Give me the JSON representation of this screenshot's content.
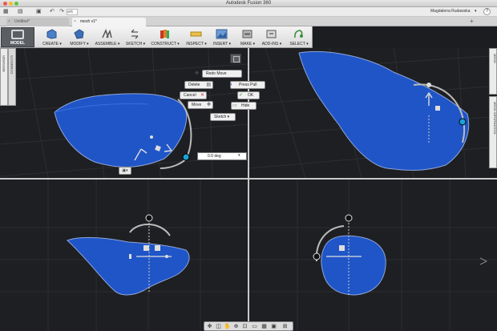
{
  "window": {
    "title": "Autodesk Fusion 360"
  },
  "quick_access": {
    "project": "ark",
    "user": "Magdalena Rudawska",
    "user_caret": "▾",
    "help": "?"
  },
  "tabs": [
    {
      "label": "Untitled*"
    },
    {
      "label": "mesh v1*"
    }
  ],
  "tab_add": "+",
  "toolbar": {
    "workspace": "MODEL",
    "tools": [
      {
        "label": "CREATE ▾",
        "color": "#3c6fb5"
      },
      {
        "label": "MODIFY ▾",
        "color": "#3c6fb5"
      },
      {
        "label": "ASSEMBLE ▾",
        "color": "#6e6e6e"
      },
      {
        "label": "SKETCH ▾",
        "color": "#6e6e6e"
      },
      {
        "label": "CONSTRUCT ▾",
        "color": "#c0392b"
      },
      {
        "label": "INSPECT ▾",
        "color": "#d1a115"
      },
      {
        "label": "INSERT ▾",
        "color": "#4a7ab8"
      },
      {
        "label": "MAKE ▾",
        "color": "#555555"
      },
      {
        "label": "ADD-INS ▾",
        "color": "#555555"
      },
      {
        "label": "SELECT ▾",
        "color": "#3f8f3f"
      }
    ]
  },
  "panels": {
    "browser": "BROWSER",
    "comments": "COMMENTS",
    "right_top": "MESH",
    "right_bottom": "MESH INFORMATION"
  },
  "manipulator": {
    "redo_move": "Redo Move",
    "delete": "Delete",
    "press_pull": "Press Pull",
    "cancel": "Cancel",
    "ok": "OK",
    "move": "Move",
    "hide": "Hide",
    "sketch": "Sketch ▾",
    "angle_value": "0.0 deg"
  },
  "colors": {
    "mesh": "#1f55c7",
    "viewport_bg": "#1e1f22",
    "grid": "#2e3036",
    "accent": "#1aa3d6"
  },
  "icons": [
    "delete-icon",
    "cancel-icon",
    "ok-icon",
    "move-icon",
    "hide-icon",
    "redo-move-icon",
    "press-pull-icon"
  ]
}
